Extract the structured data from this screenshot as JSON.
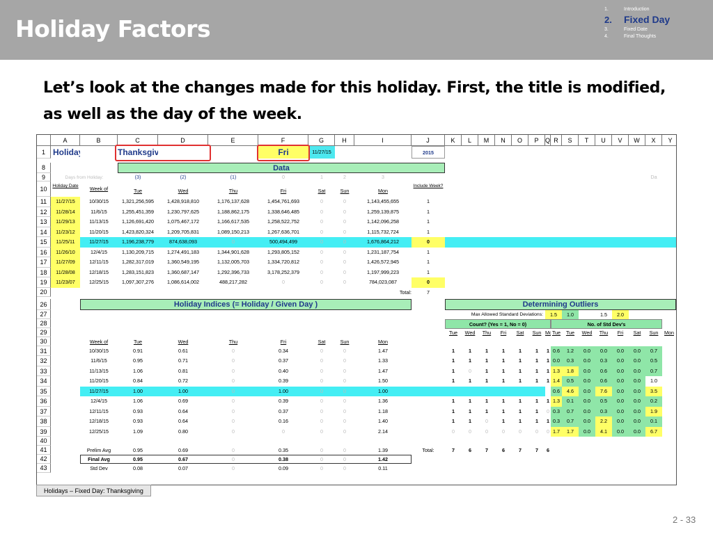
{
  "slide": {
    "title": "Holiday Factors",
    "toc": [
      {
        "num": "1.",
        "label": "Introduction"
      },
      {
        "num": "2.",
        "label": "Fixed Day"
      },
      {
        "num": "3.",
        "label": "Fixed Date"
      },
      {
        "num": "4.",
        "label": "Final Thoughts"
      }
    ],
    "lead": "Let’s look at the changes made for this holiday.  First, the title is modified, as well as the day of the week.",
    "sheet_tab": "Holidays – Fixed Day:  Thanksgiving",
    "page": "2 -  33"
  },
  "sheet": {
    "columns": [
      "A",
      "B",
      "C",
      "D",
      "E",
      "F",
      "G",
      "H",
      "I",
      "J",
      "K",
      "L",
      "M",
      "N",
      "O",
      "P",
      "Q",
      "R",
      "S",
      "T",
      "U",
      "V",
      "W",
      "X",
      "Y"
    ],
    "row1": {
      "holiday_label": "Holiday:",
      "holiday": "Thanksgiving",
      "day": "Fri",
      "date": "11/27/15",
      "year": "2015"
    },
    "data_title": "Data",
    "row9": {
      "label": "Days from Holiday:",
      "vals": [
        "(3)",
        "(2)",
        "(1)",
        "0",
        "1",
        "2",
        "3"
      ],
      "trail": "Da"
    },
    "row10": {
      "date": "Holiday Date",
      "week": "Week of",
      "days": [
        "Tue",
        "Wed",
        "Thu",
        "Fri",
        "Sat",
        "Sun",
        "Mon"
      ],
      "include": "Include Week?"
    },
    "data_rows": [
      {
        "rn": "11",
        "date": "11/27/15",
        "week": "10/30/15",
        "v": [
          "1,321,256,595",
          "1,428,918,810",
          "1,176,137,628",
          "1,454,761,693",
          "0",
          "0",
          "1,143,455,655"
        ],
        "inc": "1"
      },
      {
        "rn": "12",
        "date": "11/28/14",
        "week": "11/6/15",
        "v": [
          "1,255,451,359",
          "1,230,797,625",
          "1,188,862,175",
          "1,338,646,485",
          "0",
          "0",
          "1,259,139,875"
        ],
        "inc": "1"
      },
      {
        "rn": "13",
        "date": "11/29/13",
        "week": "11/13/15",
        "v": [
          "1,126,691,420",
          "1,075,467,172",
          "1,166,617,535",
          "1,258,522,752",
          "0",
          "0",
          "1,142,096,258"
        ],
        "inc": "1"
      },
      {
        "rn": "14",
        "date": "11/23/12",
        "week": "11/20/15",
        "v": [
          "1,423,820,324",
          "1,209,705,831",
          "1,089,150,213",
          "1,267,636,701",
          "0",
          "0",
          "1,115,732,724"
        ],
        "inc": "1"
      },
      {
        "rn": "15",
        "date": "11/25/11",
        "week": "11/27/15",
        "v": [
          "1,196,238,779",
          "874,638,093",
          "0",
          "500,494,499",
          "0",
          "0",
          "1,676,864,212"
        ],
        "inc": "0",
        "hl": true
      },
      {
        "rn": "16",
        "date": "11/26/10",
        "week": "12/4/15",
        "v": [
          "1,130,209,715",
          "1,274,491,183",
          "1,344,901,628",
          "1,293,805,152",
          "0",
          "0",
          "1,231,187,754"
        ],
        "inc": "1"
      },
      {
        "rn": "17",
        "date": "11/27/09",
        "week": "12/11/15",
        "v": [
          "1,282,317,019",
          "1,360,549,195",
          "1,132,005,703",
          "1,334,720,812",
          "0",
          "0",
          "1,426,572,945"
        ],
        "inc": "1"
      },
      {
        "rn": "18",
        "date": "11/28/08",
        "week": "12/18/15",
        "v": [
          "1,283,151,823",
          "1,360,687,147",
          "1,292,396,733",
          "3,178,252,379",
          "0",
          "0",
          "1,197,999,223"
        ],
        "inc": "1"
      },
      {
        "rn": "19",
        "date": "11/23/07",
        "week": "12/25/15",
        "v": [
          "1,097,307,276",
          "1,086,614,002",
          "488,217,282",
          "0",
          "0",
          "0",
          "784,023,087"
        ],
        "inc": "0"
      }
    ],
    "row20": {
      "label": "Total:",
      "value": "7"
    },
    "indices_title": "Holiday Indices  (= Holiday / Given Day )",
    "outliers_title": "Determining Outliers",
    "row27": {
      "label": "Max Allowed Standard Deviations:",
      "v1": "1.5",
      "v2": "1.0",
      "v3": "1.5",
      "v4": "2.0"
    },
    "row28": {
      "count": "Count?  (Yes = 1, No = 0)",
      "std": "No. of Std Dev's"
    },
    "row29_days": [
      "Tue",
      "Wed",
      "Thu",
      "Fri",
      "Sat",
      "Sun",
      "Mon"
    ],
    "row30": {
      "week": "Week of",
      "days": [
        "Tue",
        "Wed",
        "Thu",
        "Fri",
        "Sat",
        "Sun",
        "Mon"
      ]
    },
    "index_rows": [
      {
        "rn": "31",
        "week": "10/30/15",
        "v": [
          "0.91",
          "0.61",
          "0",
          "0.34",
          "0",
          "0",
          "1.47"
        ],
        "cnt": [
          "1",
          "1",
          "1",
          "1",
          "1",
          "1",
          "1"
        ],
        "sd": [
          "0.6",
          "1.2",
          "0.0",
          "0.0",
          "0.0",
          "0.0",
          "0.7"
        ]
      },
      {
        "rn": "32",
        "week": "11/6/15",
        "v": [
          "0.95",
          "0.71",
          "0",
          "0.37",
          "0",
          "0",
          "1.33"
        ],
        "cnt": [
          "1",
          "1",
          "1",
          "1",
          "1",
          "1",
          "1"
        ],
        "sd": [
          "0.0",
          "0.3",
          "0.0",
          "0.3",
          "0.0",
          "0.0",
          "0.5"
        ]
      },
      {
        "rn": "33",
        "week": "11/13/15",
        "v": [
          "1.06",
          "0.81",
          "0",
          "0.40",
          "0",
          "0",
          "1.47"
        ],
        "cnt": [
          "1",
          "0",
          "1",
          "1",
          "1",
          "1",
          "1"
        ],
        "sd": [
          "1.3",
          "1.8",
          "0.0",
          "0.6",
          "0.0",
          "0.0",
          "0.7"
        ]
      },
      {
        "rn": "34",
        "week": "11/20/15",
        "v": [
          "0.84",
          "0.72",
          "0",
          "0.39",
          "0",
          "0",
          "1.50"
        ],
        "cnt": [
          "1",
          "1",
          "1",
          "1",
          "1",
          "1",
          "1"
        ],
        "sd": [
          "1.4",
          "0.5",
          "0.0",
          "0.6",
          "0.0",
          "0.0",
          "1.0"
        ]
      },
      {
        "rn": "35",
        "week": "11/27/15",
        "v": [
          "1.00",
          "1.00",
          "0",
          "1.00",
          "0",
          "0",
          "1.00"
        ],
        "cnt": [
          "",
          "",
          "",
          "",
          "",
          "",
          ""
        ],
        "sd": [
          "0.6",
          "4.6",
          "0.0",
          "7.6",
          "0.0",
          "0.0",
          "3.5"
        ],
        "hl": true
      },
      {
        "rn": "36",
        "week": "12/4/15",
        "v": [
          "1.06",
          "0.69",
          "0",
          "0.39",
          "0",
          "0",
          "1.36"
        ],
        "cnt": [
          "1",
          "1",
          "1",
          "1",
          "1",
          "1",
          "1"
        ],
        "sd": [
          "1.3",
          "0.1",
          "0.0",
          "0.5",
          "0.0",
          "0.0",
          "0.2"
        ]
      },
      {
        "rn": "37",
        "week": "12/11/15",
        "v": [
          "0.93",
          "0.64",
          "0",
          "0.37",
          "0",
          "0",
          "1.18"
        ],
        "cnt": [
          "1",
          "1",
          "1",
          "1",
          "1",
          "1",
          "0"
        ],
        "sd": [
          "0.3",
          "0.7",
          "0.0",
          "0.3",
          "0.0",
          "0.0",
          "1.9"
        ]
      },
      {
        "rn": "38",
        "week": "12/18/15",
        "v": [
          "0.93",
          "0.64",
          "0",
          "0.16",
          "0",
          "0",
          "1.40"
        ],
        "cnt": [
          "1",
          "1",
          "0",
          "1",
          "1",
          "1",
          "1"
        ],
        "sd": [
          "0.3",
          "0.7",
          "0.0",
          "2.2",
          "0.0",
          "0.0",
          "0.1"
        ]
      },
      {
        "rn": "39",
        "week": "12/25/15",
        "v": [
          "1.09",
          "0.80",
          "0",
          "0",
          "0",
          "0",
          "2.14"
        ],
        "cnt": [
          "0",
          "0",
          "0",
          "0",
          "0",
          "0",
          "0"
        ],
        "sd": [
          "1.7",
          "1.7",
          "0.0",
          "4.1",
          "0.0",
          "0.0",
          "6.7"
        ]
      }
    ],
    "row41": {
      "label": "Prelim Avg",
      "v": [
        "0.95",
        "0.69",
        "0",
        "0.35",
        "0",
        "0",
        "1.39"
      ],
      "total_label": "Total:",
      "totals": [
        "7",
        "6",
        "7",
        "6",
        "7",
        "7",
        "6"
      ]
    },
    "row42": {
      "label": "Final Avg",
      "v": [
        "0.95",
        "0.67",
        "0",
        "0.38",
        "0",
        "0",
        "1.42"
      ]
    },
    "row43": {
      "label": "Std Dev",
      "v": [
        "0.08",
        "0.07",
        "0",
        "0.09",
        "0",
        "0",
        "0.11"
      ]
    }
  },
  "colors": {
    "header_band": "#a6a6a6",
    "highlight_row": "#44eef4",
    "section_fill": "#a8eeb8",
    "yellow": "#ffff66",
    "outline": "#e03030"
  }
}
